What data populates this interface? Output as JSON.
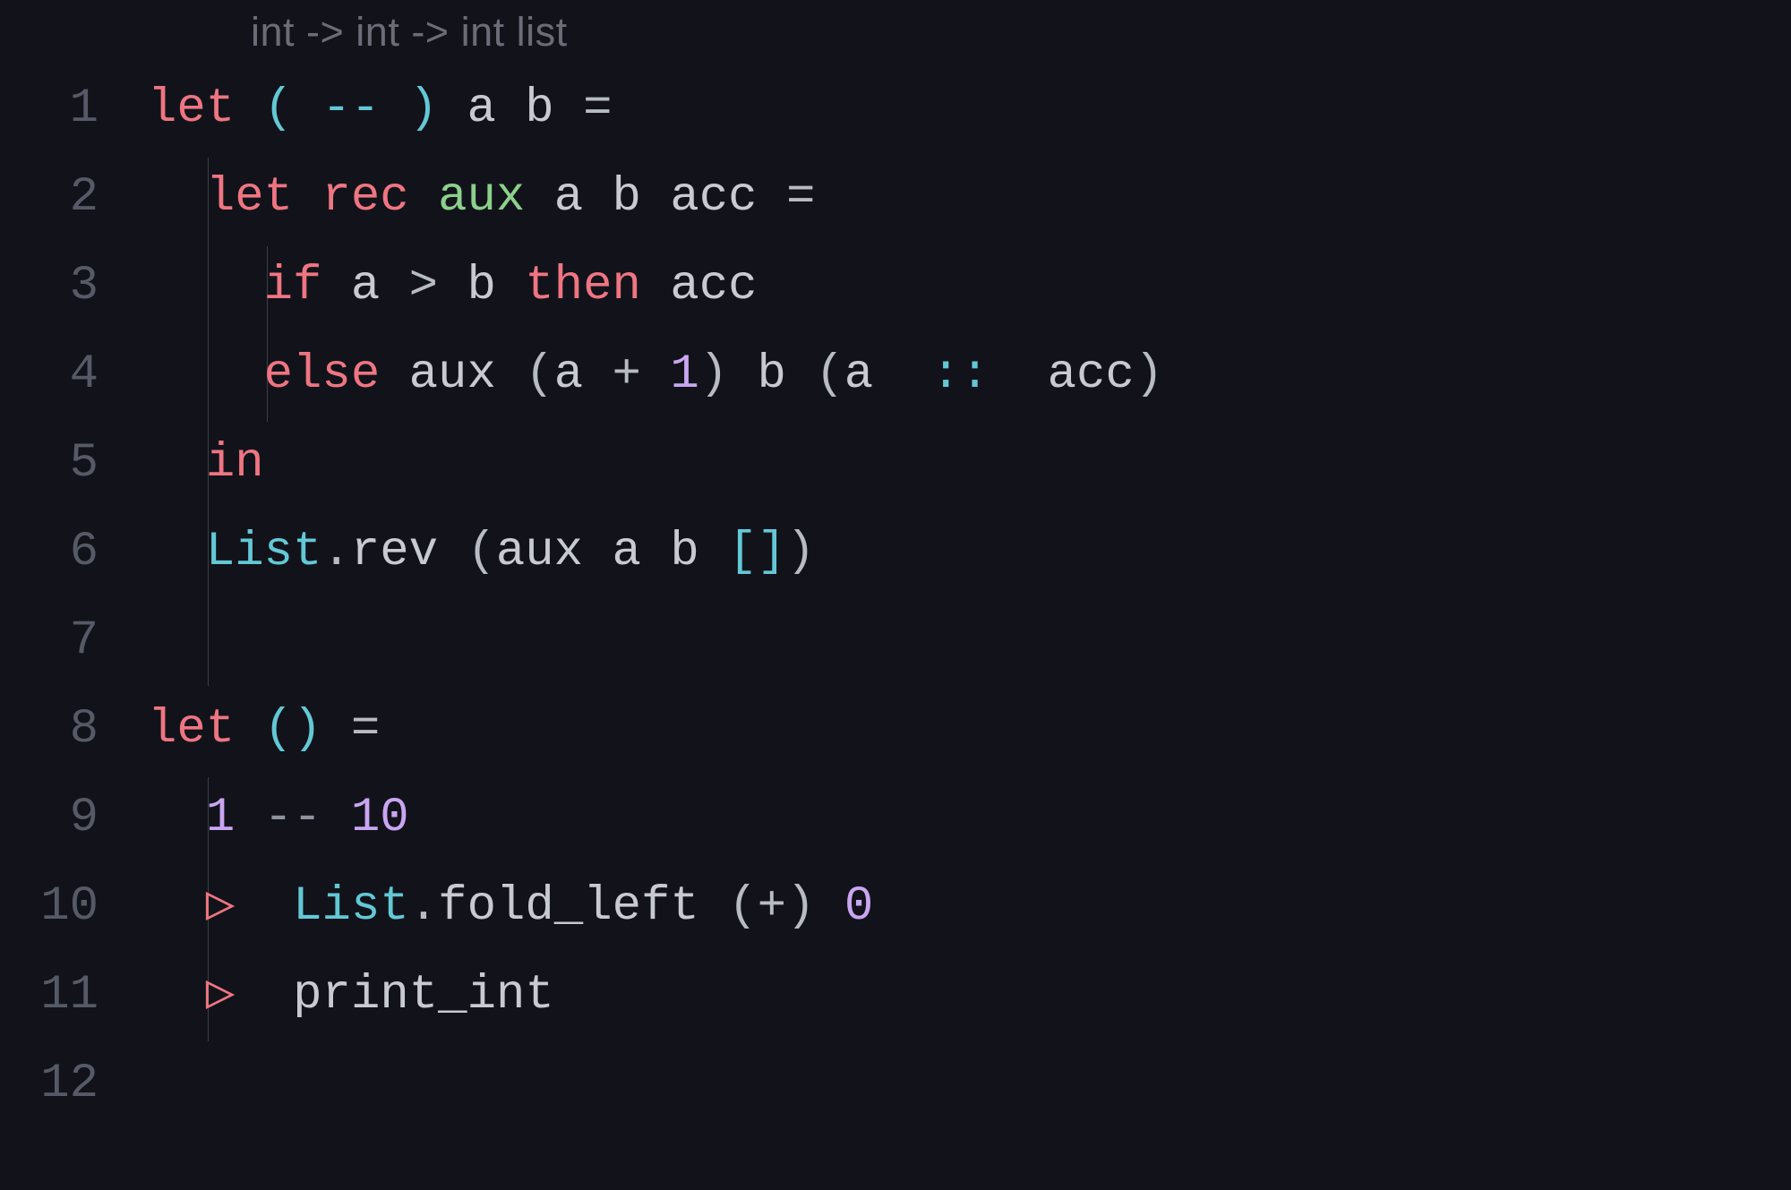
{
  "hint": "int -> int -> int list",
  "line_numbers": [
    "1",
    "2",
    "3",
    "4",
    "5",
    "6",
    "7",
    "8",
    "9",
    "10",
    "11",
    "12"
  ],
  "code": {
    "l1": {
      "let": "let ",
      "paren_o": "( ",
      "op": "--",
      "paren_c": " )",
      "sp": " ",
      "a": "a",
      "sp2": " ",
      "b": "b",
      "sp3": " ",
      "eq": "="
    },
    "l2": {
      "indent": "  ",
      "let": "let ",
      "rec": "rec ",
      "fn": "aux",
      "sp": " ",
      "a": "a",
      "sp2": " ",
      "b": "b",
      "sp3": " ",
      "acc": "acc",
      "sp4": " ",
      "eq": "="
    },
    "l3": {
      "indent": "    ",
      "if": "if ",
      "a": "a",
      "gt": " > ",
      "b": "b",
      "then": " then ",
      "acc": "acc"
    },
    "l4": {
      "indent": "    ",
      "else": "else ",
      "aux": "aux ",
      "po1": "(",
      "a": "a",
      "plus": " + ",
      "one": "1",
      "pc1": ")",
      "sp": " ",
      "b": "b",
      "sp2": " ",
      "po2": "(",
      "a2": "a",
      "cons": "  ::  ",
      "acc": "acc",
      "pc2": ")"
    },
    "l5": {
      "indent": "  ",
      "in": "in"
    },
    "l6": {
      "indent": "  ",
      "mod": "List",
      "dot": ".",
      "rev": "rev ",
      "po": "(",
      "aux": "aux ",
      "a": "a",
      "sp": " ",
      "b": "b",
      "sp2": " ",
      "bo": "[",
      "bc": "]",
      "pc": ")"
    },
    "l7": {
      "blank": ""
    },
    "l8": {
      "let": "let ",
      "po": "(",
      "pc": ")",
      "sp": " ",
      "eq": "="
    },
    "l9": {
      "indent": "  ",
      "one": "1",
      "op": " -- ",
      "ten": "10"
    },
    "l10": {
      "indent": "  ",
      "pipe": "▷",
      "sp": "  ",
      "mod": "List",
      "dot": ".",
      "fold": "fold_left ",
      "po": "(",
      "plus": "+",
      "pc": ")",
      "sp2": " ",
      "zero": "0"
    },
    "l11": {
      "indent": "  ",
      "pipe": "▷",
      "sp": "  ",
      "print": "print_int"
    },
    "l12": {
      "blank": ""
    }
  }
}
